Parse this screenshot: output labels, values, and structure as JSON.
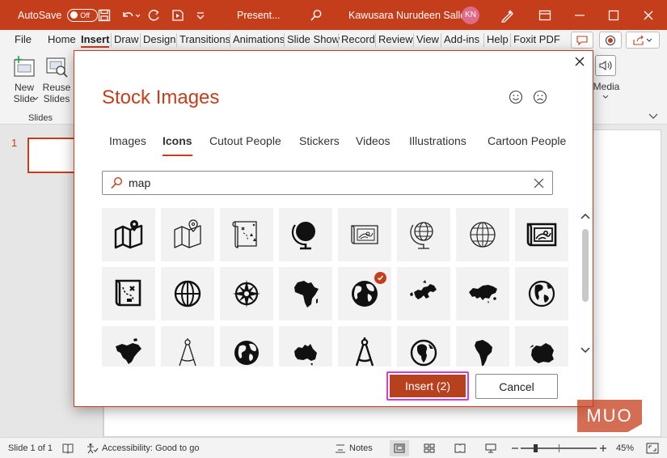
{
  "titlebar": {
    "autosave_label": "AutoSave",
    "autosave_state": "Off",
    "doc_name": "Present...",
    "user_name": "Kawusara Nurudeen Salley",
    "user_initials": "KN"
  },
  "ribbon_tabs": [
    "File",
    "Home",
    "Insert",
    "Draw",
    "Design",
    "Transitions",
    "Animations",
    "Slide Show",
    "Record",
    "Review",
    "View",
    "Add-ins",
    "Help",
    "Foxit PDF"
  ],
  "ribbon": {
    "new_slide": "New\nSlide",
    "reuse_slides": "Reuse\nSlides",
    "group_slides": "Slides",
    "media": "Media"
  },
  "slide_panel": {
    "slide_number": "1"
  },
  "dialog": {
    "title": "Stock Images",
    "tabs": [
      "Images",
      "Icons",
      "Cutout People",
      "Stickers",
      "Videos",
      "Illustrations",
      "Cartoon People"
    ],
    "active_tab": "Icons",
    "search_value": "map",
    "insert_label": "Insert (2)",
    "cancel_label": "Cancel",
    "icons": [
      [
        "folded-map-pin",
        "folded-map-pin-outline",
        "treasure-map-scroll",
        "desk-globe",
        "topographic-map-outline",
        "globe-stand-outline",
        "globe-outline",
        "topographic-map"
      ],
      [
        "treasure-map-x",
        "globe-grid",
        "compass-rose",
        "africa",
        "earth-selected",
        "europe",
        "eurasia",
        "earth-americas"
      ],
      [
        "north-america",
        "drafting-compass",
        "earth",
        "australia",
        "drafting-compass",
        "earth-africa",
        "south-america",
        "antarctica"
      ]
    ],
    "selected_icon": "earth-selected"
  },
  "statusbar": {
    "slide_info": "Slide 1 of 1",
    "accessibility": "Accessibility: Good to go",
    "notes": "Notes",
    "zoom": "45%"
  },
  "watermark": "MUO",
  "colors": {
    "accent": "#c43e1c",
    "insert_button": "#b7411e",
    "highlight_border": "#d13ec9"
  }
}
